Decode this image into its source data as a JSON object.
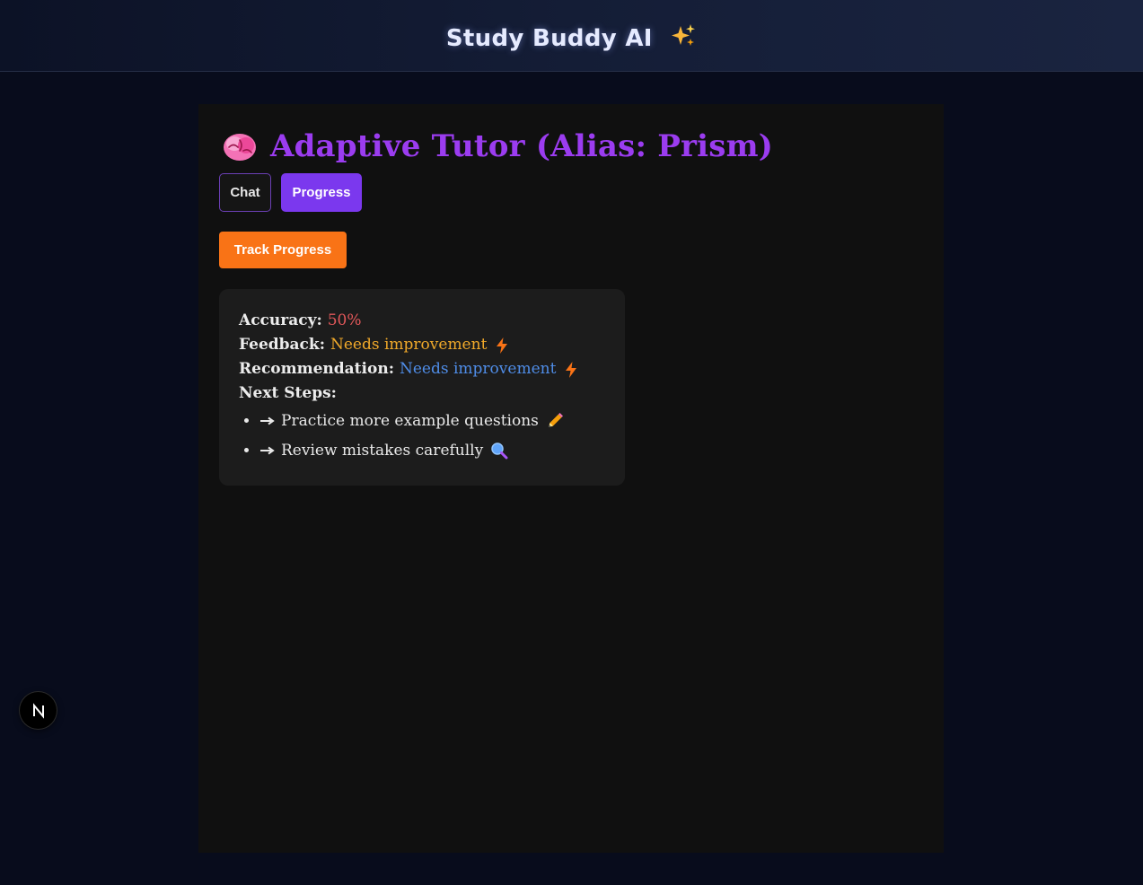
{
  "header": {
    "title": "Study Buddy AI",
    "icon": "sparkles-icon"
  },
  "main": {
    "title_icon": "brain-icon",
    "title": "Adaptive Tutor (Alias: Prism)",
    "tabs": [
      {
        "label": "Chat",
        "active": false
      },
      {
        "label": "Progress",
        "active": true
      }
    ],
    "track_button": "Track Progress",
    "report": {
      "accuracy_label": "Accuracy:",
      "accuracy_value": "50%",
      "feedback_label": "Feedback:",
      "feedback_value": "Needs improvement",
      "recommendation_label": "Recommendation:",
      "recommendation_value": "Needs improvement",
      "next_steps_label": "Next Steps:",
      "next_steps": [
        {
          "text": "Practice more example questions",
          "icon": "pencil-icon"
        },
        {
          "text": "Review mistakes carefully",
          "icon": "magnifier-icon"
        }
      ]
    }
  },
  "colors": {
    "background": "#080c1c",
    "panel": "#101010",
    "title_purple": "#9b3cf0",
    "tab_active": "#7b38ee",
    "button_orange": "#f97316",
    "accuracy_red": "#e2585a",
    "feedback_amber": "#f0a92a",
    "recommendation_blue": "#4f8de8"
  },
  "dev_badge": {
    "letter": "N",
    "icon": "nextjs-icon"
  }
}
